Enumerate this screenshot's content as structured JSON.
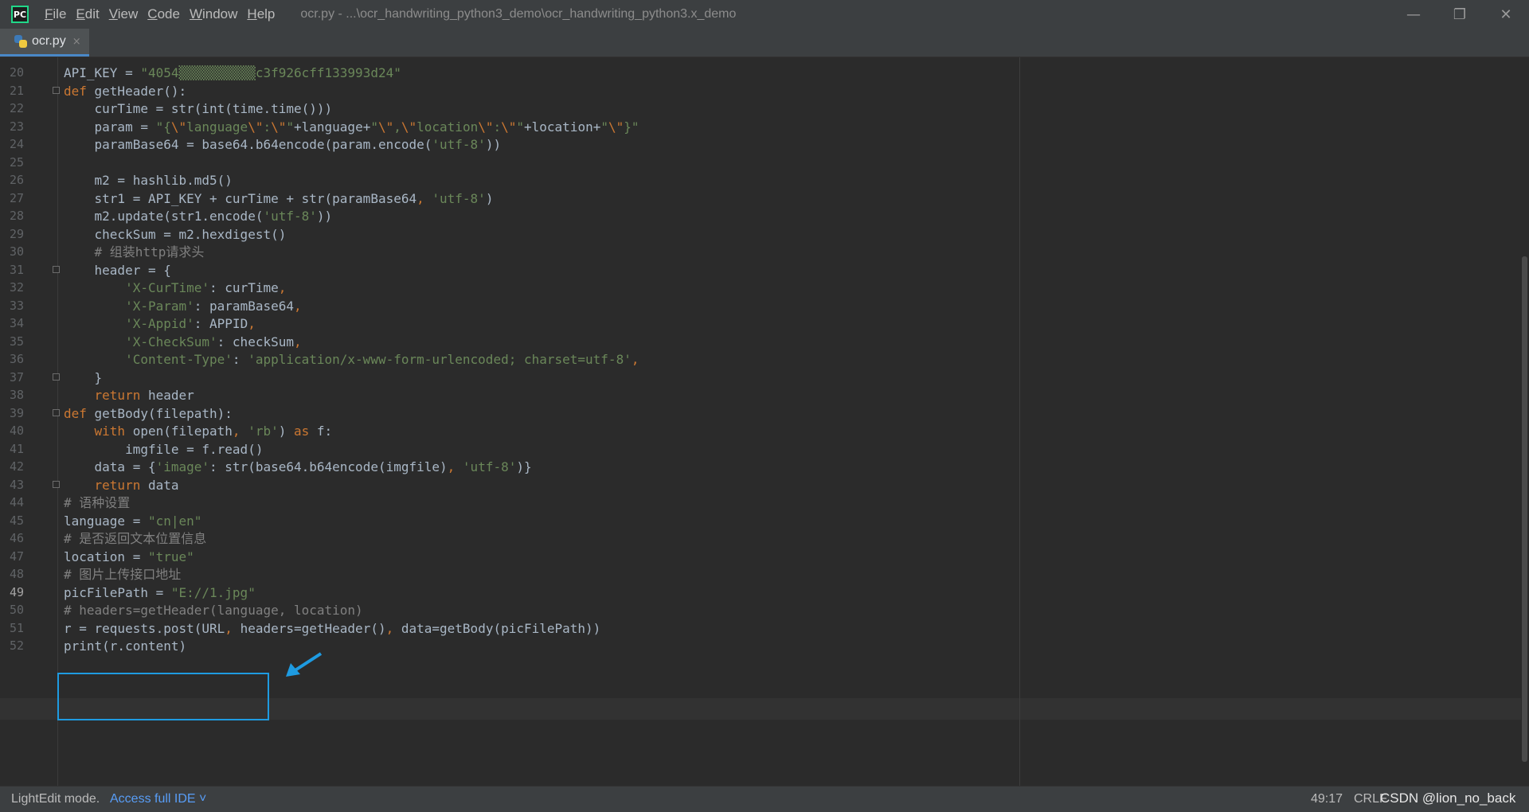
{
  "titlebar": {
    "logo_text": "PC",
    "menus": [
      {
        "mnemonic": "F",
        "rest": "ile"
      },
      {
        "mnemonic": "E",
        "rest": "dit"
      },
      {
        "mnemonic": "V",
        "rest": "iew"
      },
      {
        "mnemonic": "C",
        "rest": "ode"
      },
      {
        "mnemonic": "W",
        "rest": "indow"
      },
      {
        "mnemonic": "H",
        "rest": "elp"
      }
    ],
    "title": "ocr.py - ...\\ocr_handwriting_python3_demo\\ocr_handwriting_python3.x_demo",
    "controls": {
      "minimize": "—",
      "restore": "❐",
      "close": "✕"
    }
  },
  "tab": {
    "label": "ocr.py",
    "close": "×",
    "icon": "python-file-icon"
  },
  "status": {
    "mode": "LightEdit mode.",
    "link": "Access full IDE ˅",
    "position": "49:17",
    "eol": "CRLF",
    "watermark": "CSDN @lion_no_back"
  },
  "colors": {
    "keyword": "#cc7832",
    "string": "#6a8759",
    "comment": "#808080",
    "annotation": "#1e9be1",
    "link": "#589df6"
  },
  "editor": {
    "active_line": "49",
    "lines": [
      {
        "n": "20",
        "fold": false,
        "tokens": [
          [
            "API_KEY = ",
            ""
          ],
          [
            "\"4054",
            "str"
          ],
          [
            "▒▒▒▒▒▒▒▒▒▒",
            "str"
          ],
          [
            "c3f926cff133993d24\"",
            "str"
          ]
        ]
      },
      {
        "n": "21",
        "fold": true,
        "tokens": [
          [
            "def ",
            "kw"
          ],
          [
            "getHeader():",
            ""
          ]
        ]
      },
      {
        "n": "22",
        "fold": false,
        "tokens": [
          [
            "    curTime = str(int(time.time()))",
            ""
          ]
        ]
      },
      {
        "n": "23",
        "fold": false,
        "tokens": [
          [
            "    param = ",
            ""
          ],
          [
            "\"{",
            "str"
          ],
          [
            "\\\"",
            "esc"
          ],
          [
            "language",
            "str"
          ],
          [
            "\\\"",
            "esc"
          ],
          [
            ":",
            "str"
          ],
          [
            "\\\"",
            "esc"
          ],
          [
            "\"",
            "str"
          ],
          [
            "+language+",
            ""
          ],
          [
            "\"",
            "str"
          ],
          [
            "\\\"",
            "esc"
          ],
          [
            ",",
            "str"
          ],
          [
            "\\\"",
            "esc"
          ],
          [
            "location",
            "str"
          ],
          [
            "\\\"",
            "esc"
          ],
          [
            ":",
            "str"
          ],
          [
            "\\\"",
            "esc"
          ],
          [
            "\"",
            "str"
          ],
          [
            "+location+",
            ""
          ],
          [
            "\"",
            "str"
          ],
          [
            "\\\"",
            "esc"
          ],
          [
            "}\"",
            "str"
          ]
        ]
      },
      {
        "n": "24",
        "fold": false,
        "tokens": [
          [
            "    paramBase64 = base64.b64encode(param.encode(",
            ""
          ],
          [
            "'utf-8'",
            "str"
          ],
          [
            "))",
            ""
          ]
        ]
      },
      {
        "n": "25",
        "fold": false,
        "tokens": [
          [
            "",
            ""
          ]
        ]
      },
      {
        "n": "26",
        "fold": false,
        "tokens": [
          [
            "    m2 = hashlib.md5()",
            ""
          ]
        ]
      },
      {
        "n": "27",
        "fold": false,
        "tokens": [
          [
            "    str1 = API_KEY + curTime + str(paramBase64",
            ""
          ],
          [
            ", ",
            "kw"
          ],
          [
            "'utf-8'",
            "str"
          ],
          [
            ")",
            ""
          ]
        ]
      },
      {
        "n": "28",
        "fold": false,
        "tokens": [
          [
            "    m2.update(str1.encode(",
            ""
          ],
          [
            "'utf-8'",
            "str"
          ],
          [
            "))",
            ""
          ]
        ]
      },
      {
        "n": "29",
        "fold": false,
        "tokens": [
          [
            "    checkSum = m2.hexdigest()",
            ""
          ]
        ]
      },
      {
        "n": "30",
        "fold": false,
        "tokens": [
          [
            "    # 组装http请求头",
            "cm"
          ]
        ]
      },
      {
        "n": "31",
        "fold": true,
        "tokens": [
          [
            "    header = {",
            ""
          ]
        ]
      },
      {
        "n": "32",
        "fold": false,
        "tokens": [
          [
            "        ",
            ""
          ],
          [
            "'X-CurTime'",
            "str"
          ],
          [
            ": curTime",
            ""
          ],
          [
            ",",
            "kw"
          ]
        ]
      },
      {
        "n": "33",
        "fold": false,
        "tokens": [
          [
            "        ",
            ""
          ],
          [
            "'X-Param'",
            "str"
          ],
          [
            ": paramBase64",
            ""
          ],
          [
            ",",
            "kw"
          ]
        ]
      },
      {
        "n": "34",
        "fold": false,
        "tokens": [
          [
            "        ",
            ""
          ],
          [
            "'X-Appid'",
            "str"
          ],
          [
            ": APPID",
            ""
          ],
          [
            ",",
            "kw"
          ]
        ]
      },
      {
        "n": "35",
        "fold": false,
        "tokens": [
          [
            "        ",
            ""
          ],
          [
            "'X-CheckSum'",
            "str"
          ],
          [
            ": checkSum",
            ""
          ],
          [
            ",",
            "kw"
          ]
        ]
      },
      {
        "n": "36",
        "fold": false,
        "tokens": [
          [
            "        ",
            ""
          ],
          [
            "'Content-Type'",
            "str"
          ],
          [
            ": ",
            ""
          ],
          [
            "'application/x-www-form-urlencoded; charset=utf-8'",
            "str"
          ],
          [
            ",",
            "kw"
          ]
        ]
      },
      {
        "n": "37",
        "fold": true,
        "tokens": [
          [
            "    }",
            ""
          ]
        ]
      },
      {
        "n": "38",
        "fold": false,
        "tokens": [
          [
            "    ",
            ""
          ],
          [
            "return",
            "kw"
          ],
          [
            " header",
            ""
          ]
        ]
      },
      {
        "n": "39",
        "fold": true,
        "tokens": [
          [
            "def ",
            "kw"
          ],
          [
            "getBody(filepath):",
            ""
          ]
        ]
      },
      {
        "n": "40",
        "fold": false,
        "tokens": [
          [
            "    ",
            ""
          ],
          [
            "with",
            "kw"
          ],
          [
            " open(filepath",
            ""
          ],
          [
            ", ",
            "kw"
          ],
          [
            "'rb'",
            "str"
          ],
          [
            ") ",
            ""
          ],
          [
            "as",
            "kw"
          ],
          [
            " f:",
            ""
          ]
        ]
      },
      {
        "n": "41",
        "fold": false,
        "tokens": [
          [
            "        imgfile = f.read()",
            ""
          ]
        ]
      },
      {
        "n": "42",
        "fold": false,
        "tokens": [
          [
            "    data = {",
            ""
          ],
          [
            "'image'",
            "str"
          ],
          [
            ": str(base64.b64encode(imgfile)",
            ""
          ],
          [
            ", ",
            "kw"
          ],
          [
            "'utf-8'",
            "str"
          ],
          [
            ")}",
            ""
          ]
        ]
      },
      {
        "n": "43",
        "fold": true,
        "tokens": [
          [
            "    ",
            ""
          ],
          [
            "return",
            "kw"
          ],
          [
            " data",
            ""
          ]
        ]
      },
      {
        "n": "44",
        "fold": false,
        "tokens": [
          [
            "# 语种设置",
            "cm"
          ]
        ]
      },
      {
        "n": "45",
        "fold": false,
        "tokens": [
          [
            "language = ",
            ""
          ],
          [
            "\"cn|en\"",
            "str"
          ]
        ]
      },
      {
        "n": "46",
        "fold": false,
        "tokens": [
          [
            "# 是否返回文本位置信息",
            "cm"
          ]
        ]
      },
      {
        "n": "47",
        "fold": false,
        "tokens": [
          [
            "location = ",
            ""
          ],
          [
            "\"true\"",
            "str"
          ]
        ]
      },
      {
        "n": "48",
        "fold": false,
        "tokens": [
          [
            "# 图片上传接口地址",
            "cm"
          ]
        ]
      },
      {
        "n": "49",
        "fold": false,
        "tokens": [
          [
            "picFilePath = ",
            ""
          ],
          [
            "\"E://1.jpg\"",
            "str"
          ]
        ]
      },
      {
        "n": "50",
        "fold": false,
        "tokens": [
          [
            "# headers=getHeader(language, location)",
            "cm"
          ]
        ]
      },
      {
        "n": "51",
        "fold": false,
        "tokens": [
          [
            "r = requests.post(URL",
            ""
          ],
          [
            ", ",
            "kw"
          ],
          [
            "headers=getHeader()",
            ""
          ],
          [
            ", ",
            "kw"
          ],
          [
            "data=getBody(picFilePath))",
            ""
          ]
        ]
      },
      {
        "n": "52",
        "fold": false,
        "tokens": [
          [
            "print(r.content)",
            ""
          ]
        ]
      }
    ]
  }
}
